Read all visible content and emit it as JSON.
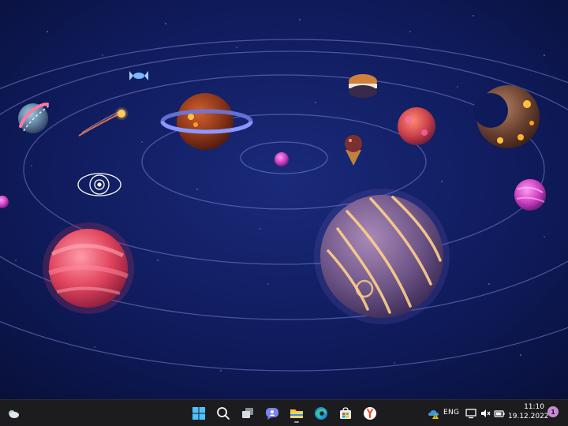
{
  "taskbar": {
    "widgets_icon": "weather-cloud-icon",
    "pinned": [
      {
        "name": "start-button",
        "icon": "windows-logo-icon"
      },
      {
        "name": "search-button",
        "icon": "search-icon"
      },
      {
        "name": "task-view-button",
        "icon": "task-view-icon"
      },
      {
        "name": "teams-chat-button",
        "icon": "chat-icon"
      },
      {
        "name": "file-explorer-button",
        "icon": "folder-icon"
      },
      {
        "name": "edge-browser-button",
        "icon": "edge-icon"
      },
      {
        "name": "microsoft-store-button",
        "icon": "store-icon"
      },
      {
        "name": "yandex-browser-button",
        "icon": "yandex-icon"
      }
    ],
    "tray": {
      "language": "ENG",
      "time": "11:10",
      "date": "19.12.2022",
      "notification_count": "1"
    }
  },
  "colors": {
    "taskbar_bg": "#1c1c1f",
    "wallpaper_top": "#0c1446",
    "wallpaper_bottom": "#0a1a55",
    "notification_badge": "#c98bd6"
  }
}
